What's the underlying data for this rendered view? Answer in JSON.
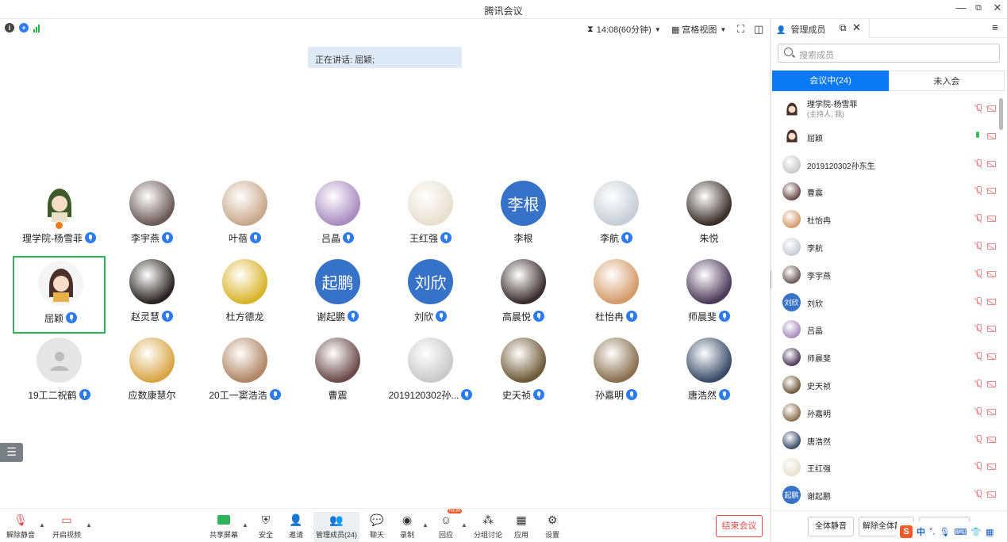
{
  "window": {
    "title": "腾讯会议"
  },
  "topbar": {
    "time": "14:08(60分钟)",
    "view": "宫格视图"
  },
  "speaking_banner": "正在讲话: 屈颖;",
  "grid": [
    {
      "name": "理学院-杨雪菲",
      "kind": "cartoon-girl",
      "bg": "#ffffff",
      "mic": true,
      "host": true
    },
    {
      "name": "李宇燕",
      "kind": "photo",
      "bg": "#6a5a58",
      "mic": true
    },
    {
      "name": "叶蓓",
      "kind": "photo",
      "bg": "#c9a98c",
      "mic": true
    },
    {
      "name": "吕晶",
      "kind": "photo",
      "bg": "#a98cc0",
      "mic": true
    },
    {
      "name": "王红强",
      "kind": "photo",
      "bg": "#e8e0d0",
      "mic": true
    },
    {
      "name": "李根",
      "kind": "text",
      "initials": "李根",
      "bg": "#3673c8",
      "mic": false
    },
    {
      "name": "李航",
      "kind": "photo",
      "bg": "#c7cdd6",
      "mic": true
    },
    {
      "name": "朱悦",
      "kind": "photo",
      "bg": "#3a2e2a",
      "mic": false
    },
    {
      "name": "屈颖",
      "kind": "cartoon-girl2",
      "bg": "#f5f5f5",
      "mic": true,
      "active": true
    },
    {
      "name": "赵灵慧",
      "kind": "photo",
      "bg": "#2a2222",
      "mic": true
    },
    {
      "name": "杜方德龙",
      "kind": "photo",
      "bg": "#d9b42a",
      "mic": false
    },
    {
      "name": "谢起鹏",
      "kind": "text",
      "initials": "起鹏",
      "bg": "#3673c8",
      "mic": true
    },
    {
      "name": "刘欣",
      "kind": "text",
      "initials": "刘欣",
      "bg": "#3673c8",
      "mic": true
    },
    {
      "name": "高晨悦",
      "kind": "photo",
      "bg": "#3a2c2c",
      "mic": true
    },
    {
      "name": "杜怡冉",
      "kind": "photo",
      "bg": "#d49a6a",
      "mic": true
    },
    {
      "name": "师晨斐",
      "kind": "photo",
      "bg": "#4d3a5a",
      "mic": true
    },
    {
      "name": "19工二祝鹤",
      "kind": "placeholder",
      "bg": "#e6e6e6",
      "mic": true
    },
    {
      "name": "应数康慧尔",
      "kind": "photo",
      "bg": "#d8a545",
      "mic": false
    },
    {
      "name": "20工一窦浩浩",
      "kind": "photo",
      "bg": "#b08666",
      "mic": true
    },
    {
      "name": "曹震",
      "kind": "photo",
      "bg": "#6b4a4a",
      "mic": false
    },
    {
      "name": "2019120302孙...",
      "kind": "photo",
      "bg": "#c9c9c9",
      "mic": true
    },
    {
      "name": "史天祯",
      "kind": "photo",
      "bg": "#6f5a3a",
      "mic": true
    },
    {
      "name": "孙嘉明",
      "kind": "photo",
      "bg": "#8a7050",
      "mic": true
    },
    {
      "name": "唐浩然",
      "kind": "photo",
      "bg": "#3a4a68",
      "mic": true
    }
  ],
  "toolbar": {
    "unmute": "解除静音",
    "start_video": "开启视频",
    "share": "共享屏幕",
    "security": "安全",
    "invite": "邀请",
    "members": "管理成员(24)",
    "chat": "聊天",
    "record": "录制",
    "react": "回应",
    "breakout": "分组讨论",
    "apps": "应用",
    "settings": "设置",
    "end": "结束会议",
    "new_badge": "NEW"
  },
  "panel": {
    "title": "管理成员",
    "search_placeholder": "搜索成员",
    "tab_in": "会议中(24)",
    "tab_out": "未入会",
    "mute_all": "全体静音",
    "unmute_all": "解除全体静音",
    "more": "全部解禁..."
  },
  "members": [
    {
      "name": "理学院-杨雪菲",
      "sub": "(主持人, 我)",
      "bg": "#ffffff",
      "kind": "cartoon"
    },
    {
      "name": "屈颖",
      "bg": "#f5f5f5",
      "kind": "cartoon",
      "speaking": true
    },
    {
      "name": "2019120302孙东生",
      "bg": "#c9c9c9"
    },
    {
      "name": "曹震",
      "bg": "#6b4a4a"
    },
    {
      "name": "杜怡冉",
      "bg": "#d49a6a"
    },
    {
      "name": "李航",
      "bg": "#c7cdd6"
    },
    {
      "name": "李宇燕",
      "bg": "#6a5a58"
    },
    {
      "name": "刘欣",
      "bg": "#3673c8",
      "initials": "刘欣"
    },
    {
      "name": "吕晶",
      "bg": "#a98cc0"
    },
    {
      "name": "师晨斐",
      "bg": "#4d3a5a"
    },
    {
      "name": "史天祯",
      "bg": "#6f5a3a"
    },
    {
      "name": "孙嘉明",
      "bg": "#8a7050"
    },
    {
      "name": "唐浩然",
      "bg": "#3a4a68"
    },
    {
      "name": "王红强",
      "bg": "#e8e0d0"
    },
    {
      "name": "谢起鹏",
      "bg": "#3673c8",
      "initials": "起鹏"
    }
  ],
  "ime": {
    "label": "中"
  }
}
